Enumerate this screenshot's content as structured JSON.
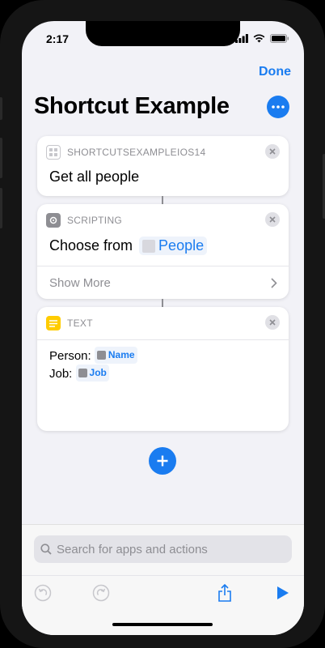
{
  "status_bar": {
    "time": "2:17"
  },
  "nav": {
    "done_label": "Done"
  },
  "page": {
    "title": "Shortcut Example"
  },
  "actions": [
    {
      "app_label": "SHORTCUTSEXAMPLEIOS14",
      "body": "Get all people"
    },
    {
      "app_label": "SCRIPTING",
      "body_prefix": "Choose from",
      "variable": "People",
      "show_more": "Show More"
    },
    {
      "app_label": "TEXT",
      "lines": [
        {
          "label": "Person:",
          "variable": "Name"
        },
        {
          "label": "Job:",
          "variable": "Job"
        }
      ]
    }
  ],
  "search": {
    "placeholder": "Search for apps and actions"
  },
  "colors": {
    "accent": "#1a7cf0",
    "text_icon": "#ffcc00",
    "background": "#f2f2f7"
  },
  "icons": [
    "search-icon",
    "undo-icon",
    "redo-icon",
    "share-icon",
    "play-icon",
    "plus-icon",
    "more-icon",
    "close-icon",
    "chevron-right-icon"
  ]
}
